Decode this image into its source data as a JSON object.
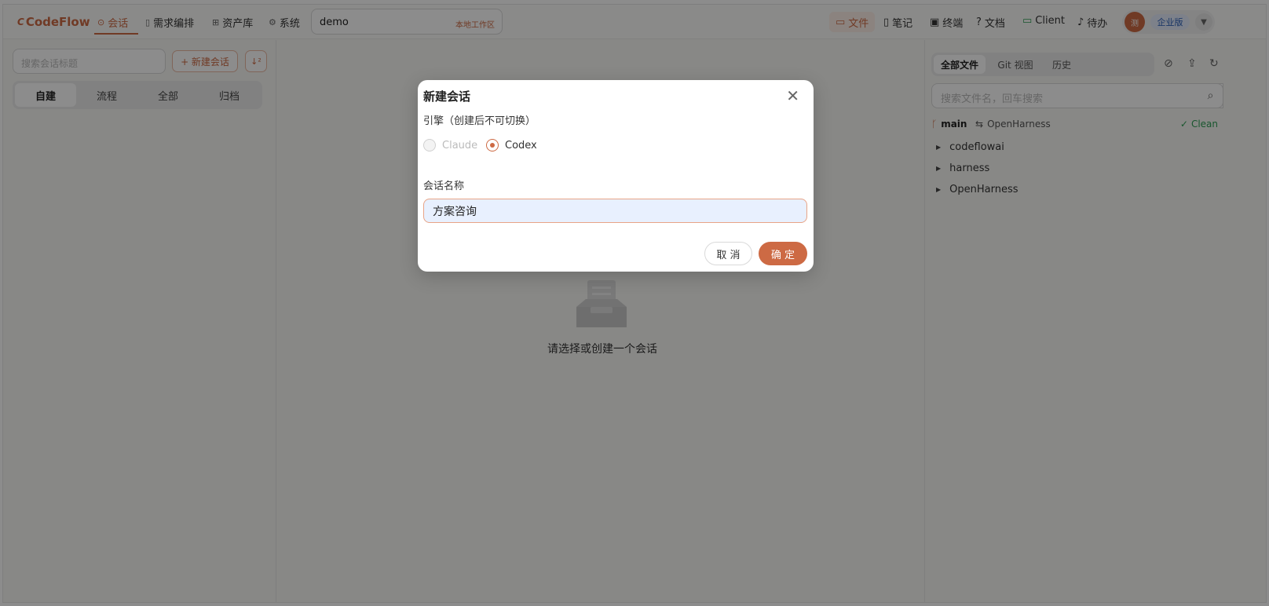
{
  "app": {
    "logo": "CodeFlow",
    "logo_mark": "C"
  },
  "nav": [
    {
      "label": "会话",
      "icon": "chat-icon",
      "active": true
    },
    {
      "label": "需求编排",
      "icon": "doc-icon",
      "active": false
    },
    {
      "label": "资产库",
      "icon": "assets-icon",
      "active": false
    },
    {
      "label": "系统",
      "icon": "gear-icon",
      "active": false
    }
  ],
  "workspace": {
    "name": "demo",
    "tag": "本地工作区"
  },
  "right_nav": [
    {
      "label": "文件",
      "icon": "folder-icon",
      "active": true
    },
    {
      "label": "笔记",
      "icon": "note-icon",
      "active": false
    },
    {
      "label": "终端",
      "icon": "terminal-icon",
      "active": false
    },
    {
      "label": "文档",
      "icon": "help-icon",
      "active": false
    },
    {
      "label": "Client",
      "icon": "monitor-icon",
      "active": false
    },
    {
      "label": "待办",
      "icon": "bell-icon",
      "active": false
    }
  ],
  "user": {
    "avatar": "测",
    "edition": "企业版"
  },
  "left": {
    "search_placeholder": "搜索会话标题",
    "new_button": "+ 新建会话",
    "tabs": [
      "自建",
      "流程",
      "全部",
      "归档"
    ]
  },
  "center": {
    "empty_text": "请选择或创建一个会话"
  },
  "right": {
    "tabs": [
      "全部文件",
      "Git 视图",
      "历史"
    ],
    "search_placeholder": "搜索文件名，回车搜索",
    "branch": "main",
    "remote": "OpenHarness",
    "status": "Clean",
    "tree": [
      "codeflowai",
      "harness",
      "OpenHarness"
    ]
  },
  "modal": {
    "title": "新建会话",
    "engine_label": "引擎（创建后不可切换）",
    "engines": [
      {
        "label": "Claude",
        "selected": false,
        "disabled": true
      },
      {
        "label": "Codex",
        "selected": true,
        "disabled": false
      }
    ],
    "name_label": "会话名称",
    "name_value": "方案咨询",
    "cancel": "取 消",
    "ok": "确 定"
  },
  "colors": {
    "accent": "#cd6a44",
    "clean": "#2f9e55",
    "edition": "#2c5fb8"
  }
}
